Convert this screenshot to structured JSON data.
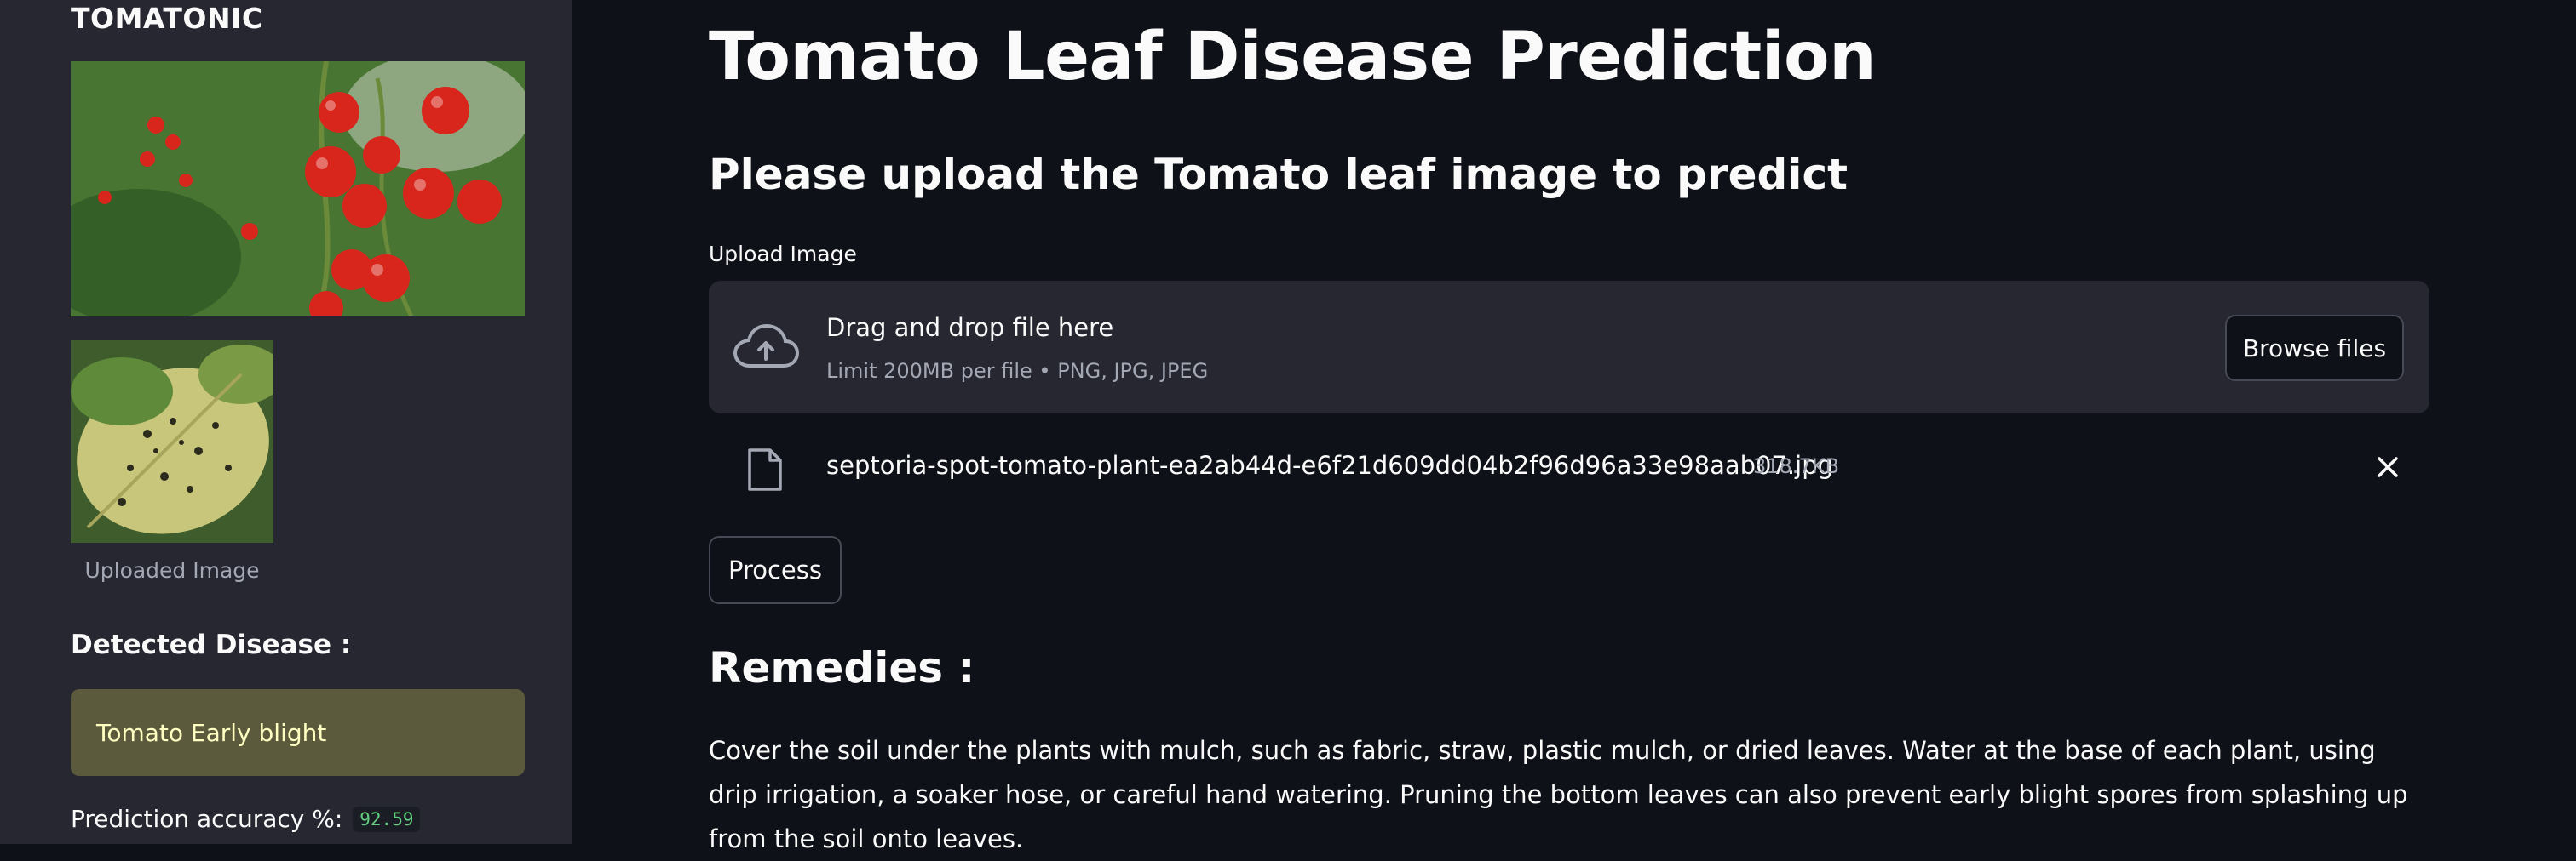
{
  "sidebar": {
    "brand": "TOMATONIC",
    "uploaded_caption": "Uploaded Image",
    "detected_heading": "Detected Disease :",
    "detected_disease": "Tomato Early blight",
    "accuracy_label": "Prediction accuracy %:",
    "accuracy_value": "92.59"
  },
  "main": {
    "title": "Tomato Leaf Disease Prediction",
    "subtitle": "Please upload the Tomato leaf image to predict",
    "upload_label": "Upload Image",
    "dropzone": {
      "title": "Drag and drop file here",
      "limit": "Limit 200MB per file • PNG, JPG, JPEG",
      "browse_label": "Browse files"
    },
    "file": {
      "name": "septoria-spot-tomato-plant-ea2ab44d-e6f21d609dd04b2f96d96a33e98aab07.jpg",
      "size": "318.7KB"
    },
    "process_label": "Process",
    "remedies_heading": "Remedies :",
    "remedies_text": "Cover the soil under the plants with mulch, such as fabric, straw, plastic mulch, or dried leaves. Water at the base of each plant, using drip irrigation, a soaker hose, or careful hand watering. Pruning the bottom leaves can also prevent early blight spores from splashing up from the soil onto leaves."
  },
  "colors": {
    "background": "#0e1117",
    "sidebar": "#262730",
    "disease_box": "#5b5a3d",
    "disease_text": "#ffffc2",
    "accuracy_value": "#62d080"
  }
}
